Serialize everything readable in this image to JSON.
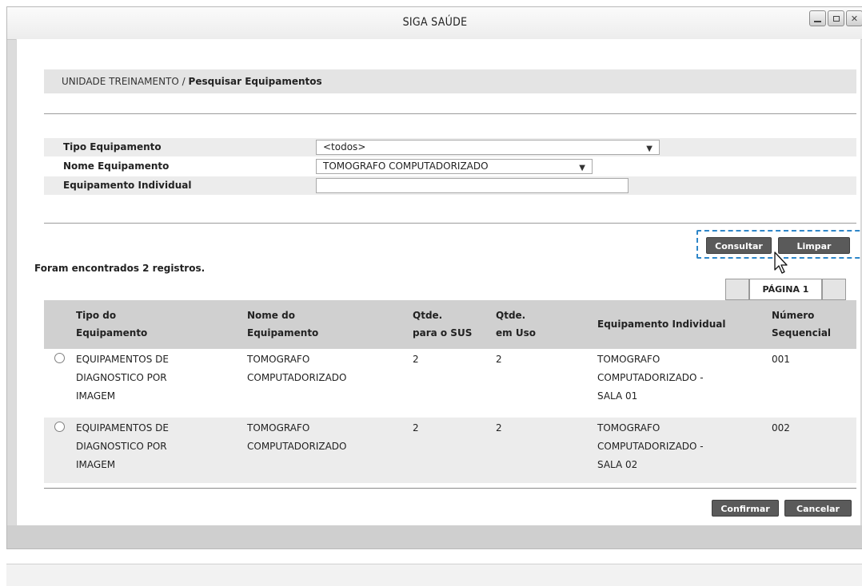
{
  "window": {
    "title": "SIGA SAÚDE"
  },
  "breadcrumb": {
    "unit": "UNIDADE TREINAMENTO /",
    "page": "Pesquisar Equipamentos"
  },
  "form": {
    "tipo_label": "Tipo Equipamento",
    "tipo_value": "<todos>",
    "nome_label": "Nome Equipamento",
    "nome_value": "TOMOGRAFO COMPUTADORIZADO",
    "individual_label": "Equipamento Individual",
    "individual_value": ""
  },
  "buttons": {
    "consultar": "Consultar",
    "limpar": "Limpar",
    "confirmar": "Confirmar",
    "cancelar": "Cancelar"
  },
  "results": {
    "count_text": "Foram encontrados 2 registros.",
    "page_label": "PÁGINA 1"
  },
  "table": {
    "headers": {
      "tipo_1": "Tipo do",
      "tipo_2": "Equipamento",
      "nome_1": "Nome do",
      "nome_2": "Equipamento",
      "sus_1": "Qtde.",
      "sus_2": "para o SUS",
      "uso_1": "Qtde.",
      "uso_2": "em Uso",
      "individual": "Equipamento Individual",
      "seq_1": "Número",
      "seq_2": "Sequencial"
    },
    "rows": [
      {
        "tipo": [
          "EQUIPAMENTOS DE",
          "DIAGNOSTICO POR",
          "IMAGEM"
        ],
        "nome": [
          "TOMOGRAFO",
          "COMPUTADORIZADO"
        ],
        "qtde_sus": "2",
        "qtde_uso": "2",
        "individual": [
          "TOMOGRAFO",
          "COMPUTADORIZADO -",
          "SALA 01"
        ],
        "seq": "001"
      },
      {
        "tipo": [
          "EQUIPAMENTOS DE",
          "DIAGNOSTICO POR",
          "IMAGEM"
        ],
        "nome": [
          "TOMOGRAFO",
          "COMPUTADORIZADO"
        ],
        "qtde_sus": "2",
        "qtde_uso": "2",
        "individual": [
          "TOMOGRAFO",
          "COMPUTADORIZADO -",
          "SALA 02"
        ],
        "seq": "002"
      }
    ]
  },
  "icons": {
    "minimize": "minimize-icon",
    "maximize": "maximize-icon",
    "close": "close-icon",
    "dropdown": "chevron-down-icon",
    "cursor": "mouse-pointer-icon"
  }
}
